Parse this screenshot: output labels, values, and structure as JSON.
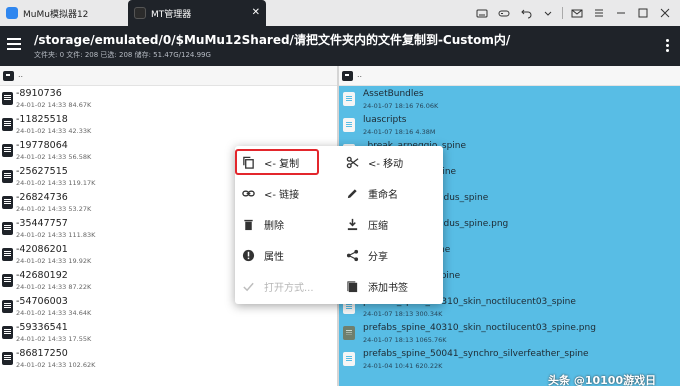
{
  "emulator": {
    "tabs": [
      {
        "label": "MuMu模拟器12",
        "icon": "mumu-app-icon"
      },
      {
        "label": "MT管理器",
        "icon": "mt-manager-app-icon",
        "close": "✕"
      }
    ],
    "controls": [
      "keyboard-icon",
      "gamepad-icon",
      "back-icon",
      "chevron-down-icon",
      "mail-icon",
      "menu-lines-icon",
      "minimize-icon",
      "restore-icon",
      "close-icon"
    ]
  },
  "header": {
    "path": "/storage/emulated/0/$MuMu12Shared/请把文件夹内的文件复制到-Custom内/",
    "summary": "文件夹: 0  文件: 208  已选: 208  储存: 51.47G/124.99G"
  },
  "left_pane": {
    "up_label": "..",
    "files": [
      {
        "name": "-8910736",
        "meta": "24-01-02 14:33  84.67K"
      },
      {
        "name": "-11825518",
        "meta": "24-01-02 14:33  42.33K"
      },
      {
        "name": "-19778064",
        "meta": "24-01-02 14:33  56.58K"
      },
      {
        "name": "-25627515",
        "meta": "24-01-02 14:33  119.17K"
      },
      {
        "name": "-26824736",
        "meta": "24-01-02 14:33  53.27K"
      },
      {
        "name": "-35447757",
        "meta": "24-01-02 14:33  111.83K"
      },
      {
        "name": "-42086201",
        "meta": "24-01-02 14:33  19.92K"
      },
      {
        "name": "-42680192",
        "meta": "24-01-02 14:33  87.22K"
      },
      {
        "name": "-54706003",
        "meta": "24-01-02 14:33  34.64K"
      },
      {
        "name": "-59336541",
        "meta": "24-01-02 14:33  17.55K"
      },
      {
        "name": "-86817250",
        "meta": "24-01-02 14:33  102.62K"
      }
    ]
  },
  "right_pane": {
    "up_label": "..",
    "files": [
      {
        "name": "AssetBundles",
        "meta": "24-01-07 18:16  76.06K",
        "type": "file"
      },
      {
        "name": "luascripts",
        "meta": "24-01-07 18:16  4.38M",
        "type": "file"
      },
      {
        "name": "_break_arpeggio_spine",
        "meta": "",
        "type": "file"
      },
      {
        "name": "_break_uillean_spine",
        "meta": "",
        "type": "file"
      },
      {
        "name": "_skin03_machairodus_spine",
        "meta": "",
        "type": "file"
      },
      {
        "name": "_skin03_machairodus_spine.png",
        "meta": "",
        "type": "file"
      },
      {
        "name": "_break_lepus_spine",
        "meta": "",
        "type": "file"
      },
      {
        "name": "_synchro_lepus_spine",
        "meta": "",
        "type": "file"
      },
      {
        "name": "prefabs_spine_40310_skin_noctilucent03_spine",
        "meta": "24-01-07 18:13  300.34K",
        "type": "file"
      },
      {
        "name": "prefabs_spine_40310_skin_noctilucent03_spine.png",
        "meta": "24-01-07 18:13  1065.76K",
        "type": "image"
      },
      {
        "name": "prefabs_spine_50041_synchro_silverfeather_spine",
        "meta": "24-01-04 10:41  620.22K",
        "type": "file"
      }
    ]
  },
  "context_menu": {
    "items": [
      {
        "label": "<- 复制",
        "icon": "copy-icon",
        "enabled": true
      },
      {
        "label": "<- 移动",
        "icon": "scissors-icon",
        "enabled": true
      },
      {
        "label": "<- 链接",
        "icon": "link-icon",
        "enabled": true
      },
      {
        "label": "重命名",
        "icon": "pencil-icon",
        "enabled": true
      },
      {
        "label": "删除",
        "icon": "trash-icon",
        "enabled": true
      },
      {
        "label": "压缩",
        "icon": "compress-icon",
        "enabled": true
      },
      {
        "label": "属性",
        "icon": "info-icon",
        "enabled": true
      },
      {
        "label": "分享",
        "icon": "share-icon",
        "enabled": true
      },
      {
        "label": "打开方式...",
        "icon": "check-icon",
        "enabled": false
      },
      {
        "label": "添加书签",
        "icon": "bookmark-icon",
        "enabled": true
      }
    ],
    "highlight_color": "#e3262c"
  },
  "watermark": "头条 @10100游戏日",
  "colors": {
    "header_bg": "#1f2329",
    "selection_bg": "#58bde5",
    "accent_red": "#e3262c"
  }
}
